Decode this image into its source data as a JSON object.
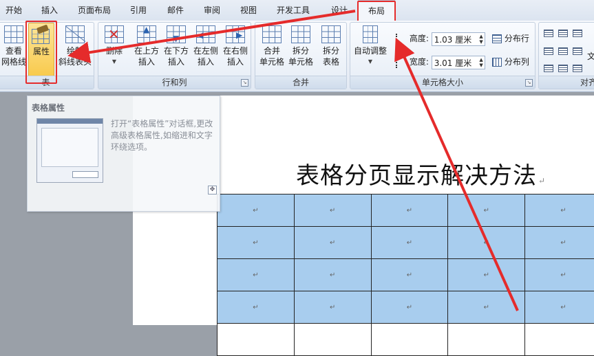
{
  "tabs": [
    "开始",
    "插入",
    "页面布局",
    "引用",
    "邮件",
    "审阅",
    "视图",
    "开发工具",
    "设计",
    "布局"
  ],
  "active_tab": "布局",
  "ribbon": {
    "table_group": {
      "label": "表",
      "buttons": [
        {
          "label": "查看\n网格线",
          "icon": "gridlines-icon"
        },
        {
          "label": "属性",
          "icon": "table-properties-icon"
        },
        {
          "label": "绘制\n斜线表头",
          "icon": "diagonal-header-icon"
        }
      ]
    },
    "rows_cols_group": {
      "label": "行和列",
      "buttons": [
        {
          "label": "删除",
          "icon": "delete-icon"
        },
        {
          "label": "在上方\n插入",
          "icon": "insert-above-icon"
        },
        {
          "label": "在下方\n插入",
          "icon": "insert-below-icon"
        },
        {
          "label": "在左侧\n插入",
          "icon": "insert-left-icon"
        },
        {
          "label": "在右侧\n插入",
          "icon": "insert-right-icon"
        }
      ]
    },
    "merge_group": {
      "label": "合并",
      "buttons": [
        {
          "label": "合并\n单元格",
          "icon": "merge-cells-icon"
        },
        {
          "label": "拆分\n单元格",
          "icon": "split-cells-icon"
        },
        {
          "label": "拆分\n表格",
          "icon": "split-table-icon"
        }
      ]
    },
    "cell_size_group": {
      "label": "单元格大小",
      "autofit_label": "自动调整",
      "height_label": "高度:",
      "height_value": "1.03 厘米",
      "width_label": "宽度:",
      "width_value": "3.01 厘米",
      "distribute_rows": "分布行",
      "distribute_cols": "分布列"
    },
    "align_group": {
      "label": "对齐",
      "text_direction_fragment": "文"
    }
  },
  "popup": {
    "title": "表格属性",
    "description": "打开“表格属性”对话框,更改高级表格属性,如缩进和文字环绕选项。"
  },
  "document": {
    "title": "表格分页显示解决方法",
    "para_mark": "↵",
    "cell_mark": "↵"
  },
  "colors": {
    "highlight_red": "#e52b2b",
    "table_fill": "#a8cdee"
  }
}
